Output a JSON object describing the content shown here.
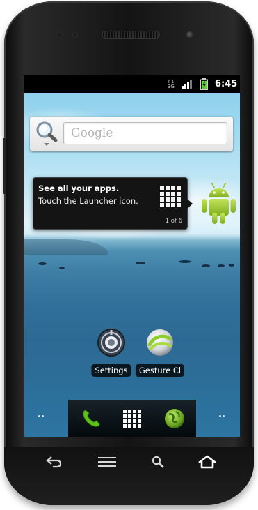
{
  "status_bar": {
    "network_type": "3G",
    "time": "6:45"
  },
  "search_widget": {
    "placeholder": "Google"
  },
  "tip": {
    "title": "See all your apps.",
    "body": "Touch the Launcher icon.",
    "page": "1 of 6"
  },
  "home_apps": [
    {
      "label": "Settings",
      "icon": "settings-icon"
    },
    {
      "label": "Gesture Cl",
      "icon": "gesture-search-icon"
    }
  ],
  "dock": {
    "items": [
      {
        "icon": "phone-icon"
      },
      {
        "icon": "app-launcher-icon"
      },
      {
        "icon": "browser-globe-icon"
      }
    ]
  },
  "nav_bar": {
    "items": [
      {
        "icon": "back-icon"
      },
      {
        "icon": "menu-icon"
      },
      {
        "icon": "search-icon"
      },
      {
        "icon": "home-icon"
      }
    ]
  },
  "colors": {
    "dock_phone_green": "#5fbf1e",
    "android_green": "#a4c639",
    "tip_background": "#141414"
  }
}
